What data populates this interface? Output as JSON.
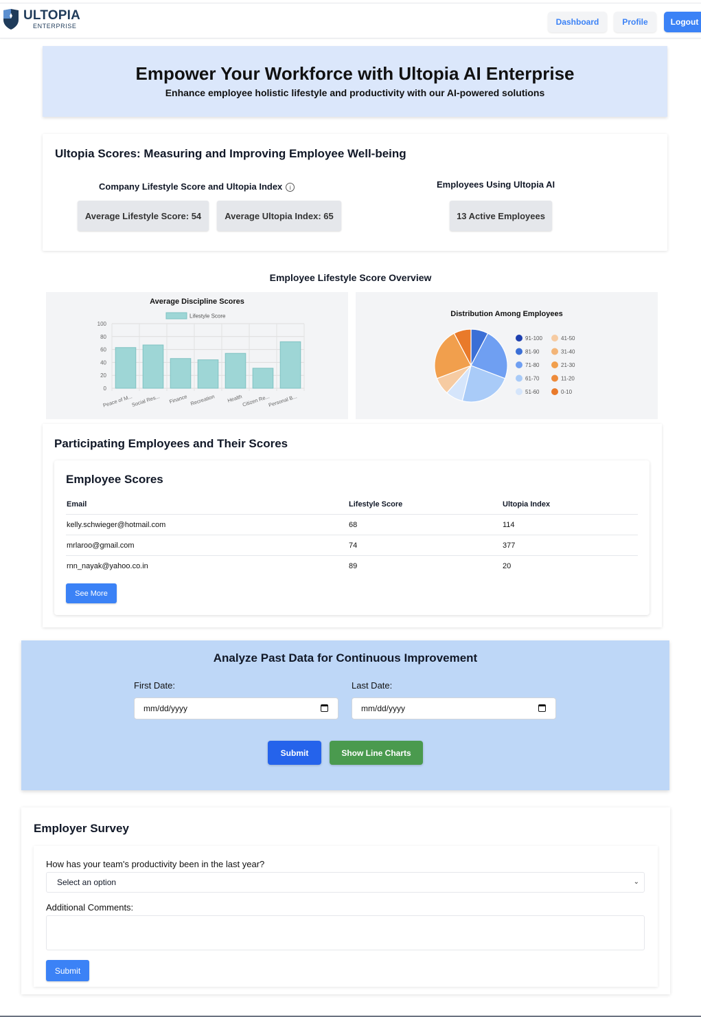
{
  "header": {
    "logo_title": "ULTOPIA",
    "logo_subtitle": "ENTERPRISE",
    "nav": {
      "dashboard": "Dashboard",
      "profile": "Profile",
      "logout": "Logout"
    }
  },
  "hero": {
    "title": "Empower Your Workforce with Ultopia AI Enterprise",
    "subtitle": "Enhance employee holistic lifestyle and productivity with our AI-powered solutions"
  },
  "scores": {
    "title": "Ultopia Scores: Measuring and Improving Employee Well-being",
    "company_heading": "Company Lifestyle Score and Ultopia Index",
    "avg_lifestyle": "Average Lifestyle Score: 54",
    "avg_index": "Average Ultopia Index: 65",
    "employees_heading": "Employees Using Ultopia AI",
    "active_employees": "13 Active Employees"
  },
  "overview": {
    "title": "Employee Lifestyle Score Overview"
  },
  "chart_data": [
    {
      "type": "bar",
      "title": "Average Discipline Scores",
      "categories": [
        "Peace of M...",
        "Social Res...",
        "Finance",
        "Recreation",
        "Health",
        "Citizen Re...",
        "Personal B..."
      ],
      "series": [
        {
          "name": "Lifestyle Score",
          "values": [
            63,
            67,
            46,
            44,
            54,
            31,
            72
          ]
        }
      ],
      "ylim": [
        0,
        100
      ],
      "yticks": [
        0,
        20,
        40,
        60,
        80,
        100
      ],
      "grid": true,
      "legend": "top",
      "color": "#9ed6d6"
    },
    {
      "type": "pie",
      "title": "Distribution Among Employees",
      "legend": "right",
      "labels": [
        "91-100",
        "81-90",
        "71-80",
        "61-70",
        "51-60",
        "41-50",
        "31-40",
        "21-30",
        "11-20",
        "0-10"
      ],
      "values": [
        0,
        1,
        3,
        3,
        1,
        1,
        0,
        3,
        0,
        1
      ],
      "colors": [
        "#1e40af",
        "#3b6fd6",
        "#6f9ff2",
        "#a9cbf8",
        "#d5e5fb",
        "#f6cba2",
        "#f3b578",
        "#f19f4d",
        "#ee8b3a",
        "#e97a2a"
      ]
    }
  ],
  "participating": {
    "title": "Participating Employees and Their Scores",
    "table_title": "Employee Scores",
    "columns": [
      "Email",
      "Lifestyle Score",
      "Ultopia Index"
    ],
    "rows": [
      [
        "kelly.schwieger@hotmail.com",
        "68",
        "114"
      ],
      [
        "mrlaroo@gmail.com",
        "74",
        "377"
      ],
      [
        "rnn_nayak@yahoo.co.in",
        "89",
        "20"
      ]
    ],
    "see_more": "See More"
  },
  "analyze": {
    "title": "Analyze Past Data for Continuous Improvement",
    "first_label": "First Date:",
    "first_placeholder": "mm/dd/yyyy",
    "last_label": "Last Date:",
    "last_placeholder": "mm/dd/yyyy",
    "submit": "Submit",
    "line_charts": "Show Line Charts"
  },
  "survey": {
    "title": "Employer Survey",
    "question": "How has your team's productivity been in the last year?",
    "select_value": "Select an option",
    "comments_label": "Additional Comments:",
    "submit": "Submit"
  },
  "icons": {
    "info": "info-icon",
    "calendar": "calendar-icon",
    "chevron": "chevron-down-icon",
    "logo": "shield-logo-icon"
  }
}
